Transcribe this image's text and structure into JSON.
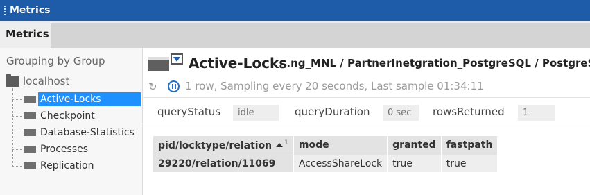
{
  "window": {
    "title": "Metrics"
  },
  "tabs": [
    {
      "label": "Metrics",
      "active": true
    }
  ],
  "sidebar": {
    "grouping_label": "Grouping by Group",
    "root": {
      "label": "localhost",
      "icon": "folder-icon"
    },
    "items": [
      {
        "label": "Active-Locks",
        "icon": "table-icon",
        "selected": true
      },
      {
        "label": "Checkpoint",
        "icon": "table-icon",
        "selected": false
      },
      {
        "label": "Database-Statistics",
        "icon": "table-icon",
        "selected": false
      },
      {
        "label": "Processes",
        "icon": "table-icon",
        "selected": false
      },
      {
        "label": "Replication",
        "icon": "table-icon",
        "selected": false
      }
    ]
  },
  "main": {
    "title": "Active-Locks",
    "breadcrumb": "...ng_MNL / PartnerInetgration_PostgreSQL / PostgreSQL",
    "status": "1 row, Sampling every 20 seconds, Last sample 01:34:11",
    "params": [
      {
        "label": "queryStatus",
        "value": "idle"
      },
      {
        "label": "queryDuration",
        "value": "0 sec"
      },
      {
        "label": "rowsReturned",
        "value": "1"
      }
    ],
    "table": {
      "columns": [
        "pid/locktype/relation",
        "mode",
        "granted",
        "fastpath"
      ],
      "sort": {
        "column": "pid/locktype/relation",
        "direction": "ascending",
        "order": "1"
      },
      "rows": [
        [
          "29220/relation/11069",
          "AccessShareLock",
          "true",
          "true"
        ]
      ]
    }
  },
  "colors": {
    "titlebar": "#1e5ba8",
    "selection": "#1e90ff",
    "pause_icon": "#1e6fd0"
  }
}
